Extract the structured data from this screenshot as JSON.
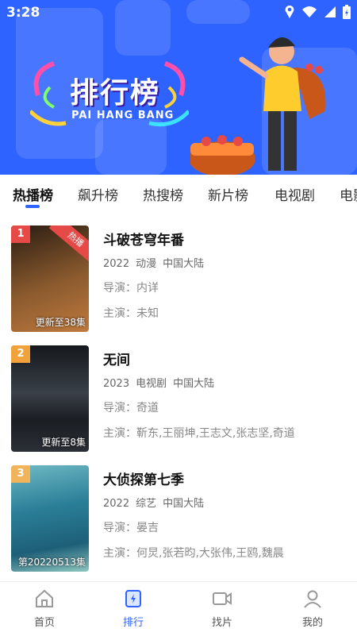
{
  "status": {
    "time": "3:28"
  },
  "banner": {
    "title": "排行榜",
    "subtitle": "PAI HANG BANG"
  },
  "tabs": [
    "热播榜",
    "飙升榜",
    "热搜榜",
    "新片榜",
    "电视剧",
    "电影"
  ],
  "items": [
    {
      "rank": "1",
      "badge": "热播",
      "episode": "更新至38集",
      "title": "斗破苍穹年番",
      "year": "2022",
      "genre": "动漫",
      "region": "中国大陆",
      "director": "导演：内详",
      "actors": "主演：未知",
      "rank_color": "#e64a47",
      "poster_colors": [
        "#3b2a1c",
        "#b8743a"
      ]
    },
    {
      "rank": "2",
      "badge": "",
      "episode": "更新至8集",
      "title": "无间",
      "year": "2023",
      "genre": "电视剧",
      "region": "中国大陆",
      "director": "导演：奇道",
      "actors": "主演：靳东,王丽坤,王志文,张志坚,奇道",
      "rank_color": "#f2a23a",
      "poster_colors": [
        "#1a1d22",
        "#4a5058"
      ]
    },
    {
      "rank": "3",
      "badge": "",
      "episode": "第20220513集",
      "title": "大侦探第七季",
      "year": "2022",
      "genre": "综艺",
      "region": "中国大陆",
      "director": "导演：晏吉",
      "actors": "主演：何炅,张若昀,大张伟,王鸥,魏晨",
      "rank_color": "#f2b45a",
      "poster_colors": [
        "#2b8aa0",
        "#9ad0c8"
      ]
    }
  ],
  "navbar": [
    {
      "label": "首页",
      "icon": "home-icon"
    },
    {
      "label": "排行",
      "icon": "ranking-icon"
    },
    {
      "label": "找片",
      "icon": "video-icon"
    },
    {
      "label": "我的",
      "icon": "user-icon"
    }
  ],
  "colors": {
    "accent": "#2f63ff",
    "banner": "#2f63ff"
  }
}
